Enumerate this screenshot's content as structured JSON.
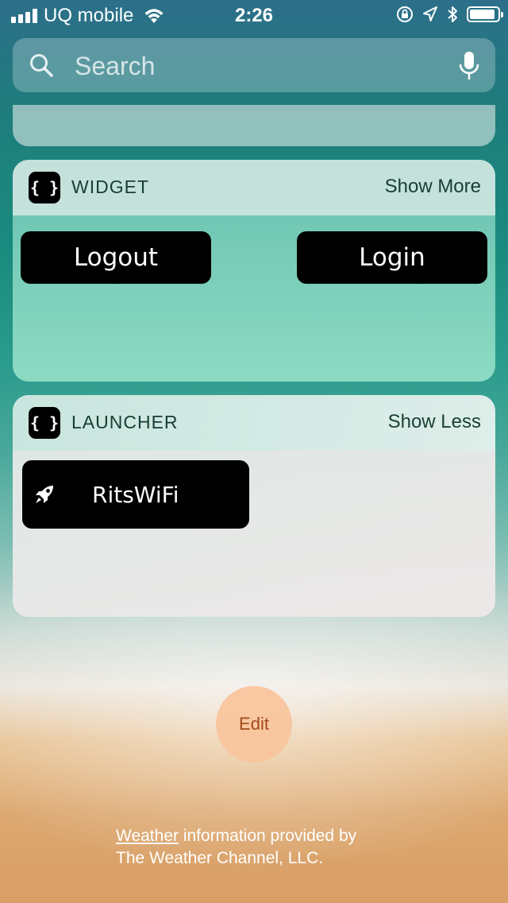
{
  "status_bar": {
    "carrier": "UQ mobile",
    "time": "2:26",
    "battery_level": 0.92
  },
  "search": {
    "placeholder": "Search"
  },
  "widgets": [
    {
      "title": "WIDGET",
      "action": "Show More",
      "icon_glyph": "{ }",
      "buttons": [
        {
          "label": "Logout"
        },
        {
          "label": "Login"
        }
      ]
    },
    {
      "title": "LAUNCHER",
      "action": "Show Less",
      "icon_glyph": "{ }",
      "items": [
        {
          "label": "RitsWiFi",
          "icon": "rocket-icon"
        }
      ]
    }
  ],
  "edit": {
    "label": "Edit"
  },
  "footer": {
    "link": "Weather",
    "text_line1": " information provided by",
    "text_line2": "The Weather Channel, LLC."
  },
  "colors": {
    "accent_text": "#173e33",
    "edit_bg": "#f8c49c",
    "edit_text": "#a44a1a"
  }
}
